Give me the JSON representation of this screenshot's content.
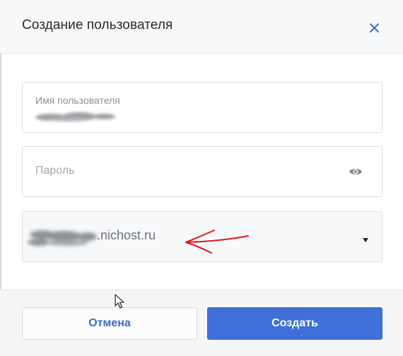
{
  "dialog": {
    "title": "Создание пользователя",
    "close_icon": "close-icon"
  },
  "form": {
    "username": {
      "label": "Имя пользователя",
      "value_redacted": true
    },
    "password": {
      "placeholder": "Пароль",
      "icon": "eye-icon"
    },
    "domain": {
      "value_suffix": ".nichost.ru",
      "value_prefix_redacted": true,
      "icon": "caret-down-icon"
    }
  },
  "footer": {
    "cancel_label": "Отмена",
    "create_label": "Создать"
  },
  "colors": {
    "accent": "#3f6fd9",
    "cancel_text": "#3d6bcf",
    "annotation": "#e0161b"
  }
}
